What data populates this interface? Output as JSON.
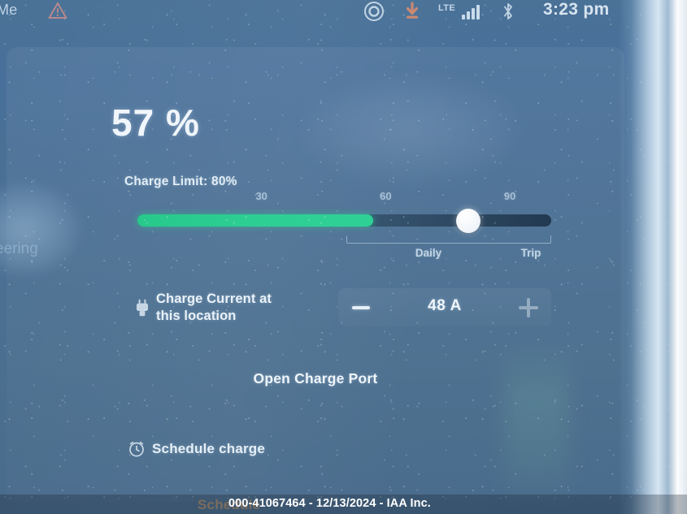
{
  "status_bar": {
    "left_label": "Me",
    "warning_icon": "warning-triangle-icon",
    "record_icon": "record-circle-icon",
    "download_icon": "download-arrow-icon",
    "network_label": "LTE",
    "signal_icon": "signal-bars-icon",
    "bluetooth_icon": "bluetooth-icon",
    "time": "3:23 pm"
  },
  "charging": {
    "battery_percent": "57 %",
    "charge_limit_label": "Charge Limit: 80%",
    "slider": {
      "ticks": [
        "30",
        "60",
        "90"
      ],
      "tick_values": [
        30,
        60,
        90
      ],
      "current_value": 80,
      "battery_value": 57,
      "min": 0,
      "max": 100,
      "fill_color": "#2ecf94",
      "knob_color": "#ffffff",
      "track_color": "#25415c",
      "daily_label": "Daily",
      "trip_label": "Trip"
    },
    "charge_current": {
      "plug_icon": "charge-plug-icon",
      "label": "Charge Current at this location",
      "label_line1": "Charge Current at",
      "label_line2": "this location",
      "decrease_label": "−",
      "value": "48 A",
      "amps": 48,
      "increase_label": "+"
    },
    "open_charge_port_label": "Open Charge Port",
    "schedule_charge": {
      "icon": "alarm-clock-icon",
      "label": "Schedule charge"
    },
    "schedule_bottom_partial": "Schedule"
  },
  "bleed": {
    "left_menu_partial": "eering"
  },
  "watermark": {
    "text": "000-41067464 - 12/13/2024 - IAA Inc."
  },
  "colors": {
    "accent_green": "#2ecf94",
    "screen_blue": "#4a6f93",
    "text_primary": "#eef5fb",
    "text_secondary": "#b9cfe2",
    "warning_red": "#c26a66"
  }
}
